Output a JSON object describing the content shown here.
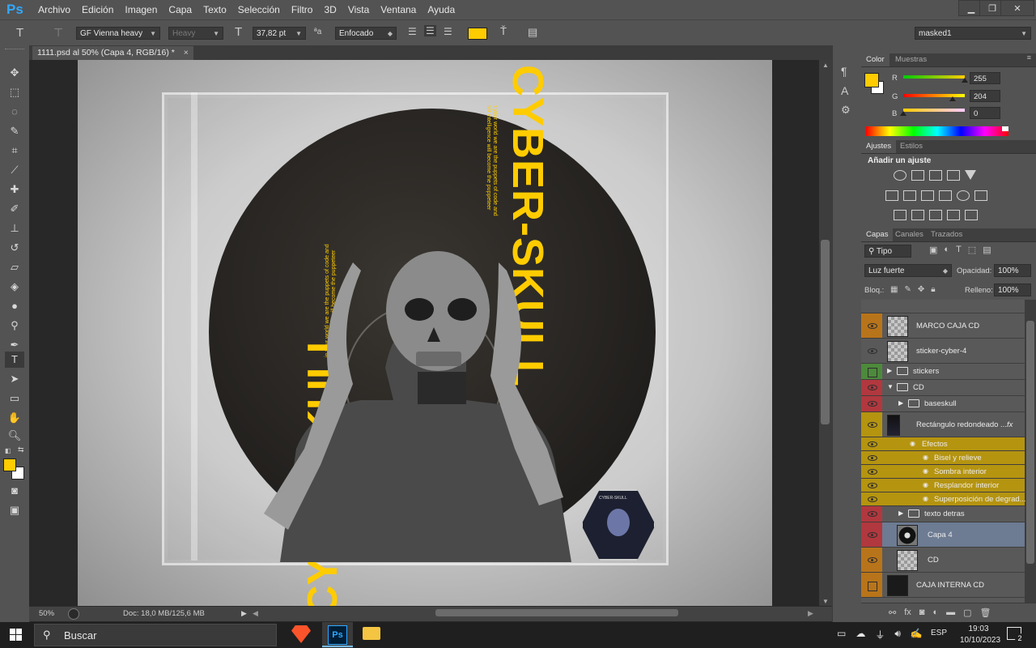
{
  "app": {
    "logo": "Ps"
  },
  "menu": [
    "Archivo",
    "Edición",
    "Imagen",
    "Capa",
    "Texto",
    "Selección",
    "Filtro",
    "3D",
    "Vista",
    "Ventana",
    "Ayuda"
  ],
  "options": {
    "font_family": "GF Vienna heavy",
    "font_style": "Heavy",
    "font_size": "37,82 pt",
    "aa_icon": "ªa",
    "antialias": "Enfocado",
    "text_color": "#ffcc00",
    "workspace": "masked1"
  },
  "document": {
    "tab_title": "1111.psd al 50% (Capa 4, RGB/16) *",
    "close_glyph": "×",
    "zoom": "50%",
    "doc_info": "Doc: 18,0 MB/125,6 MB"
  },
  "artwork": {
    "title_vertical": "CYBER-SKULL",
    "title_left": "CYBERSKULL",
    "small_copy": "in your world we are the puppets of code and that intelligence will become the puppeteer",
    "sticker_label": "CYBER-SKULL"
  },
  "color_panel": {
    "tabs": [
      "Color",
      "Muestras"
    ],
    "fg": "#ffcc00",
    "r_label": "R",
    "r_value": "255",
    "r_fill": 1.0,
    "g_label": "G",
    "g_value": "204",
    "g_fill": 0.8,
    "b_label": "B",
    "b_value": "0",
    "b_fill": 0.0
  },
  "adjustments_panel": {
    "tabs": [
      "Ajustes",
      "Estilos"
    ],
    "heading": "Añadir un ajuste"
  },
  "layers_panel": {
    "tabs": [
      "Capas",
      "Canales",
      "Trazados"
    ],
    "filter": "Tipo",
    "blend_mode": "Luz fuerte",
    "opacity_label": "Opacidad:",
    "opacity": "100%",
    "lock_label": "Bloq.:",
    "fill_label": "Relleno:",
    "fill": "100%",
    "layers": [
      {
        "name": "MARCO CAJA CD",
        "color": "orange",
        "eye": true,
        "kind": "layer"
      },
      {
        "name": "sticker-cyber-4",
        "color": "none",
        "eye": true,
        "kind": "smart"
      },
      {
        "name": "stickers",
        "color": "green",
        "eye": false,
        "kind": "group-closed"
      },
      {
        "name": "CD",
        "color": "red",
        "eye": true,
        "kind": "group-open"
      },
      {
        "name": "baseskull",
        "color": "red",
        "eye": true,
        "kind": "group-closed-nested"
      },
      {
        "name": "Rectángulo redondeado ...",
        "color": "yellow",
        "eye": true,
        "kind": "shape"
      },
      {
        "name": "Efectos",
        "color": "yellow",
        "eye": true,
        "kind": "effects"
      },
      {
        "name": "Bisel y relieve",
        "color": "yellow",
        "eye": true,
        "kind": "effect"
      },
      {
        "name": "Sombra interior",
        "color": "yellow",
        "eye": true,
        "kind": "effect"
      },
      {
        "name": "Resplandor interior",
        "color": "yellow",
        "eye": true,
        "kind": "effect"
      },
      {
        "name": "Superposición de degrad...",
        "color": "yellow",
        "eye": true,
        "kind": "effect"
      },
      {
        "name": "texto detras",
        "color": "red",
        "eye": true,
        "kind": "group-closed-nested"
      },
      {
        "name": "Capa 4",
        "color": "red",
        "eye": true,
        "kind": "selected"
      },
      {
        "name": "CD",
        "color": "orange",
        "eye": true,
        "kind": "layer-nested"
      },
      {
        "name": "CAJA INTERNA CD",
        "color": "orange",
        "eye": false,
        "kind": "layer"
      }
    ],
    "fx_glyph": "fx"
  },
  "taskbar": {
    "search": "Buscar",
    "lang": "ESP",
    "time": "19:03",
    "date": "10/10/2023",
    "notif": "2"
  }
}
